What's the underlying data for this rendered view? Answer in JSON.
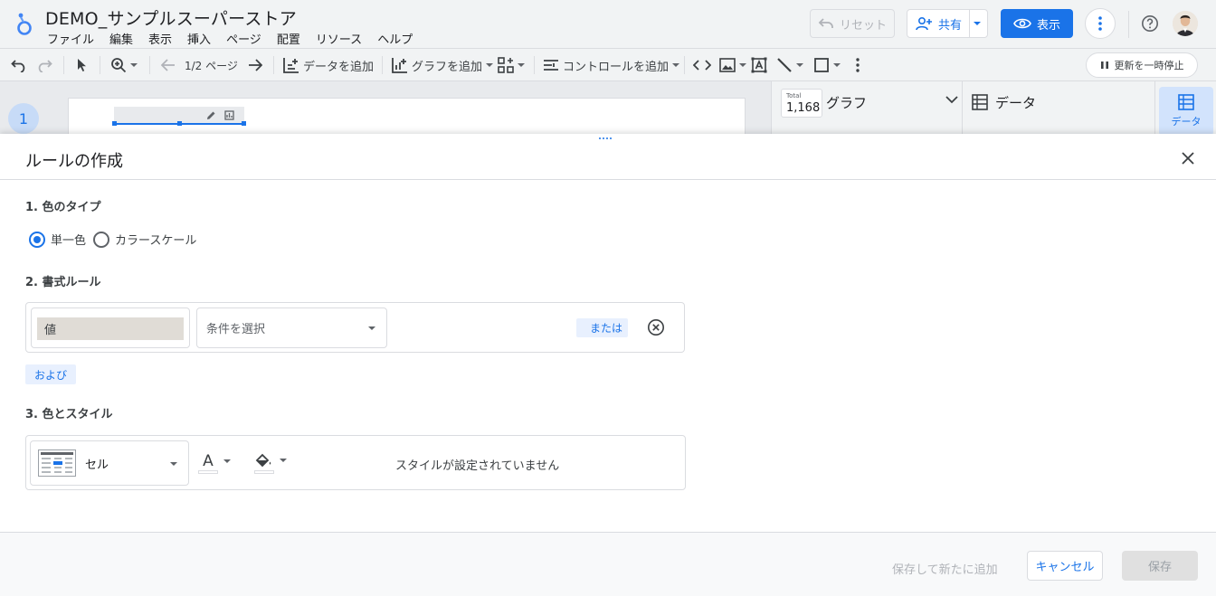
{
  "header": {
    "title": "DEMO_サンプルスーパーストア",
    "menu": [
      "ファイル",
      "編集",
      "表示",
      "挿入",
      "ページ",
      "配置",
      "リソース",
      "ヘルプ"
    ],
    "reset_label": "リセット",
    "share_label": "共有",
    "view_label": "表示",
    "brand_color": "#1a73e8"
  },
  "toolbar": {
    "page_indicator": "1/2 ページ",
    "add_data_label": "データを追加",
    "add_chart_label": "グラフを追加",
    "add_control_label": "コントロールを追加",
    "pause_update_label": "更新を一時停止"
  },
  "canvas": {
    "page_number": "1"
  },
  "right_panel": {
    "total_label": "Total",
    "total_value": "1,168",
    "chart_tab_label": "グラフ",
    "data_tab_label": "データ",
    "rail_data_label": "データ"
  },
  "dialog": {
    "title": "ルールの作成",
    "section1_title": "1. 色のタイプ",
    "color_type_options": [
      "単一色",
      "カラースケール"
    ],
    "color_type_selected": "単一色",
    "section2_title": "2. 書式ルール",
    "rule_field_value": "値",
    "condition_placeholder": "条件を選択",
    "or_label": "または",
    "and_label": "および",
    "section3_title": "3. 色とスタイル",
    "style_target_value": "セル",
    "text_color_icon_label": "A",
    "no_style_text": "スタイルが設定されていません",
    "save_and_add_label": "保存して新たに追加",
    "cancel_label": "キャンセル",
    "save_label": "保存"
  }
}
